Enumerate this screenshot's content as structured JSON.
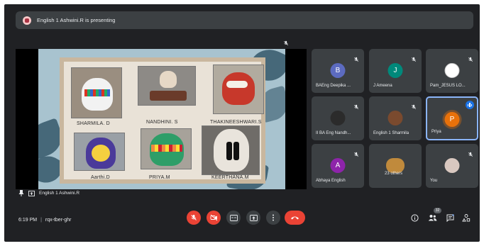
{
  "banner": {
    "text": "English 1 Ashwini.R is presenting"
  },
  "presentation": {
    "presenter_name": "English 1 Ashwini.R",
    "captions": [
      "SHARMILA. D",
      "NANDHINI. S",
      "THAKINEESHWARI.S",
      "Aarthi.D",
      "PRIYA.M",
      "KEERTHANA.M"
    ]
  },
  "participants": [
    {
      "name": "BAEng Deepika ...",
      "initial": "B",
      "color": "#5c6bc0",
      "muted": true
    },
    {
      "name": "J Ameena",
      "initial": "J",
      "color": "#00897b",
      "muted": true
    },
    {
      "name": "Pam_JESUS LO...",
      "initial": "",
      "color": "#ffffff",
      "muted": true
    },
    {
      "name": "II BA Eng Nandh...",
      "initial": "",
      "color": "#2b2b2b",
      "muted": true
    },
    {
      "name": "English 1 Sharmila",
      "initial": "",
      "color": "#7a4a2e",
      "muted": true
    },
    {
      "name": "Priya",
      "initial": "P",
      "color": "#e8710a",
      "muted": false,
      "speaking": true
    },
    {
      "name": "Abhaya English",
      "initial": "A",
      "color": "#8e24aa",
      "muted": true
    },
    {
      "name": "23 others",
      "initial": "",
      "color": "#c08a3c",
      "muted": false
    },
    {
      "name": "You",
      "initial": "",
      "color": "#d9c8c0",
      "muted": true
    }
  ],
  "footer": {
    "time": "6:19 PM",
    "meeting_code": "rqx-tber-ghr",
    "participant_count": "32"
  }
}
